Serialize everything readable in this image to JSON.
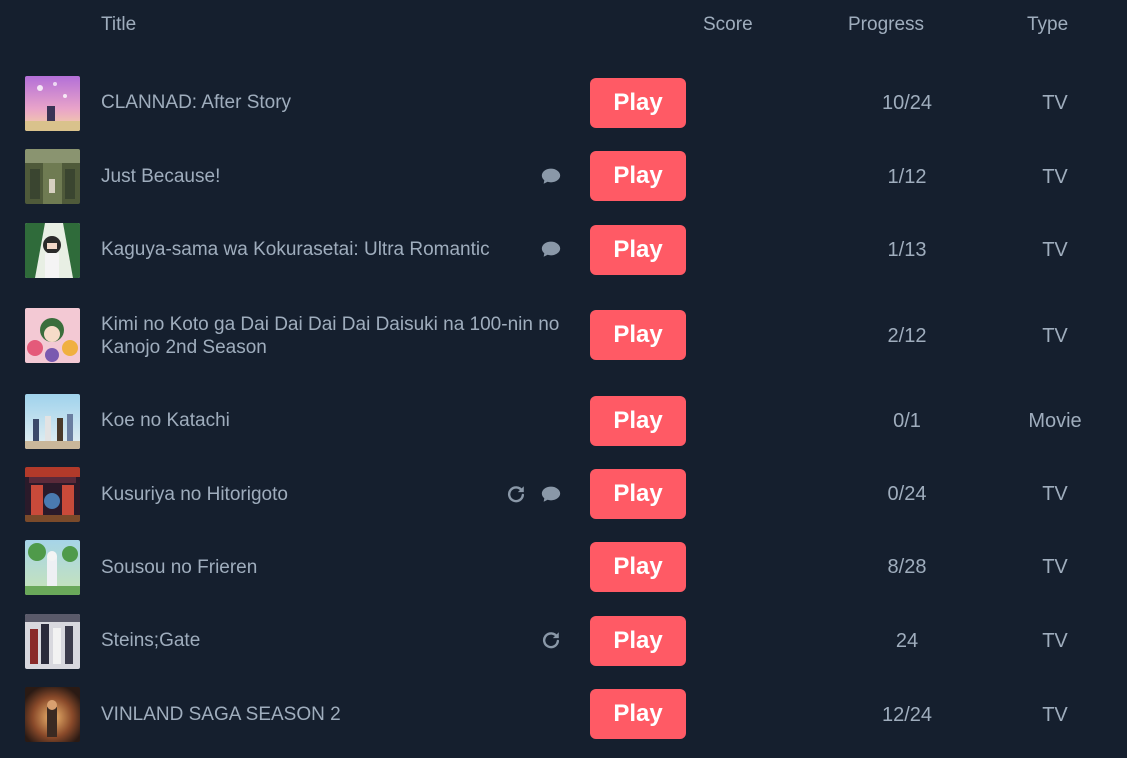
{
  "header": {
    "title": "Title",
    "score": "Score",
    "progress": "Progress",
    "type": "Type"
  },
  "accent": "#ff5a65",
  "background": "#151f2e",
  "rows": [
    {
      "title": "CLANNAD: After Story",
      "play": "Play",
      "progress": "10/24",
      "type": "TV",
      "icons": []
    },
    {
      "title": "Just Because!",
      "play": "Play",
      "progress": "1/12",
      "type": "TV",
      "icons": [
        "comment-icon"
      ]
    },
    {
      "title": "Kaguya-sama wa Kokurasetai: Ultra Romantic",
      "play": "Play",
      "progress": "1/13",
      "type": "TV",
      "icons": [
        "comment-icon"
      ]
    },
    {
      "title": "Kimi no Koto ga Dai Dai Dai Dai Daisuki na 100-nin no Kanojo 2nd Season",
      "play": "Play",
      "progress": "2/12",
      "type": "TV",
      "icons": []
    },
    {
      "title": "Koe no Katachi",
      "play": "Play",
      "progress": "0/1",
      "type": "Movie",
      "icons": []
    },
    {
      "title": "Kusuriya no Hitorigoto",
      "play": "Play",
      "progress": "0/24",
      "type": "TV",
      "icons": [
        "repeat-icon",
        "comment-icon"
      ]
    },
    {
      "title": "Sousou no Frieren",
      "play": "Play",
      "progress": "8/28",
      "type": "TV",
      "icons": []
    },
    {
      "title": "Steins;Gate",
      "play": "Play",
      "progress": "24",
      "type": "TV",
      "icons": [
        "repeat-icon"
      ]
    },
    {
      "title": "VINLAND SAGA SEASON 2",
      "play": "Play",
      "progress": "12/24",
      "type": "TV",
      "icons": []
    }
  ]
}
